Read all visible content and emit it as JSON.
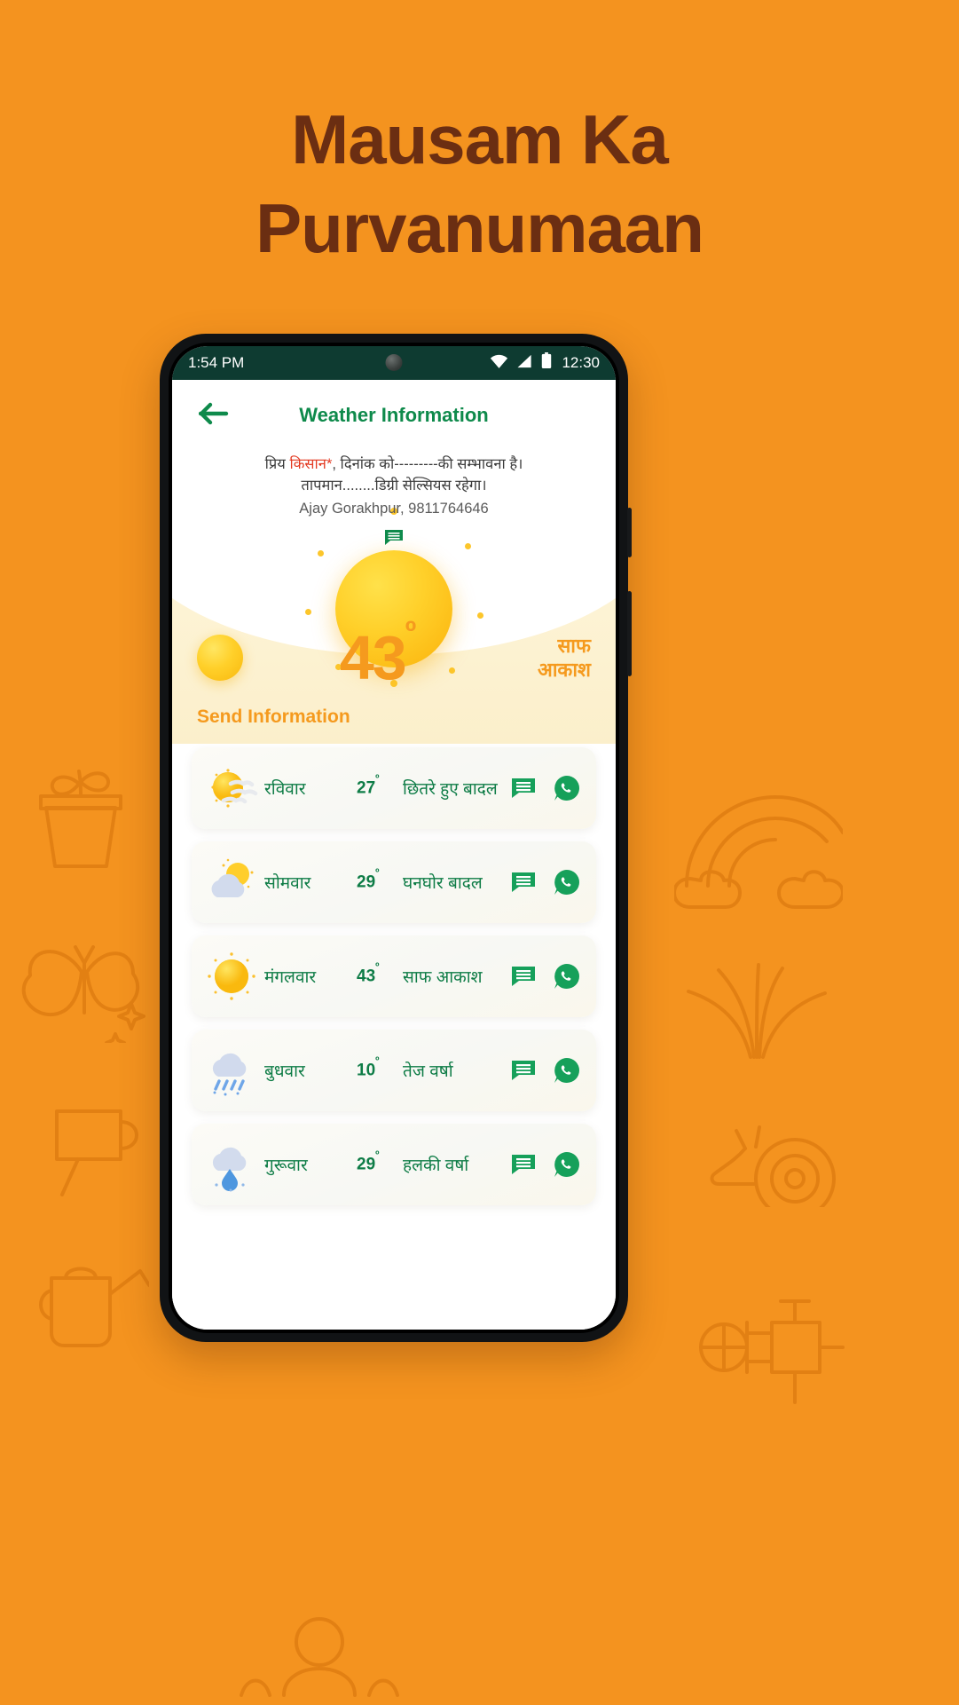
{
  "poster": {
    "background_color": "#F4931F",
    "title_line1": "Mausam Ka",
    "title_line2": "Purvanumaan",
    "title_color": "#6B2E12"
  },
  "status_bar": {
    "time_left": "1:54 PM",
    "time_right": "12:30",
    "icons": [
      "wifi-icon",
      "signal-icon",
      "battery-icon"
    ],
    "background_color": "#0E3B31"
  },
  "app_bar": {
    "back_icon": "arrow-left-icon",
    "title": "Weather Information",
    "title_color": "#0E8A4B"
  },
  "message": {
    "line1_prefix": "प्रिय ",
    "line1_highlight": "किसान*",
    "line1_suffix": ", दिनांक को---------की सम्भावना है।",
    "line2": "तापमान........डिग्री सेल्सियस रहेगा।",
    "signature": "Ajay Gorakhpur, 9811764646",
    "highlight_color": "#E33A22",
    "chat_icon": "chat-bubble-icon"
  },
  "hero": {
    "main_icon": "sun-icon",
    "side_icon": "sun-icon",
    "temperature": "43",
    "degree": "º",
    "condition": "साफ आकाश",
    "send_information_label": "Send Information",
    "accent_color": "#F59A1E"
  },
  "forecast": {
    "rows": [
      {
        "icon": "sun-cloud-wind-icon",
        "day": "रविवार",
        "temp": "27",
        "degree": "º",
        "condition": "छितरे हुए बादल",
        "sms_icon": "sms-icon",
        "whatsapp_icon": "whatsapp-icon"
      },
      {
        "icon": "cloud-sun-icon",
        "day": "सोमवार",
        "temp": "29",
        "degree": "º",
        "condition": "घनघोर बादल",
        "sms_icon": "sms-icon",
        "whatsapp_icon": "whatsapp-icon"
      },
      {
        "icon": "sun-icon",
        "day": "मंगलवार",
        "temp": "43",
        "degree": "º",
        "condition": "साफ आकाश",
        "sms_icon": "sms-icon",
        "whatsapp_icon": "whatsapp-icon"
      },
      {
        "icon": "heavy-rain-icon",
        "day": "बुधवार",
        "temp": "10",
        "degree": "º",
        "condition": "तेज वर्षा",
        "sms_icon": "sms-icon",
        "whatsapp_icon": "whatsapp-icon"
      },
      {
        "icon": "light-rain-icon",
        "day": "गुरूवार",
        "temp": "29",
        "degree": "º",
        "condition": "हलकी वर्षा",
        "sms_icon": "sms-icon",
        "whatsapp_icon": "whatsapp-icon"
      }
    ],
    "text_color": "#0E7C46"
  }
}
